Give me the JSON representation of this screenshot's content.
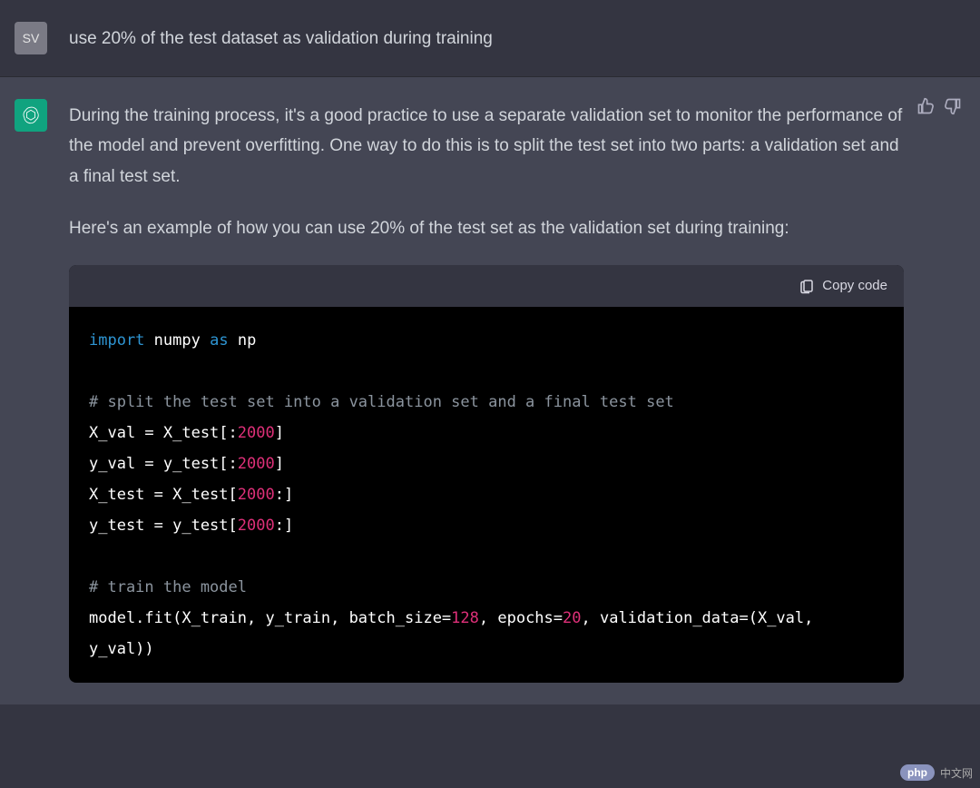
{
  "user": {
    "avatar_text": "SV",
    "message": "use 20% of the test dataset as validation during training"
  },
  "assistant": {
    "paragraph1": "During the training process, it's a good practice to use a separate validation set to monitor the performance of the model and prevent overfitting. One way to do this is to split the test set into two parts: a validation set and a final test set.",
    "paragraph2": "Here's an example of how you can use 20% of the test set as the validation set during training:",
    "copy_label": "Copy code",
    "code": {
      "kw_import": "import",
      "mod_numpy": "numpy",
      "kw_as": "as",
      "mod_np": "np",
      "comment_split": "# split the test set into a validation set and a final test set",
      "line_xval_a": "X_val = X_test[:",
      "num_2000_a": "2000",
      "line_xval_b": "]",
      "line_yval_a": "y_val = y_test[:",
      "num_2000_b": "2000",
      "line_yval_b": "]",
      "line_xtest_a": "X_test = X_test[",
      "num_2000_c": "2000",
      "line_xtest_b": ":]",
      "line_ytest_a": "y_test = y_test[",
      "num_2000_d": "2000",
      "line_ytest_b": ":]",
      "comment_train": "# train the model",
      "line_fit_a": "model.fit(X_train, y_train, batch_size=",
      "num_128": "128",
      "line_fit_b": ", epochs=",
      "num_20": "20",
      "line_fit_c": ", validation_data=(X_val, y_val))"
    }
  },
  "watermark": {
    "badge": "php",
    "text": "中文网"
  }
}
